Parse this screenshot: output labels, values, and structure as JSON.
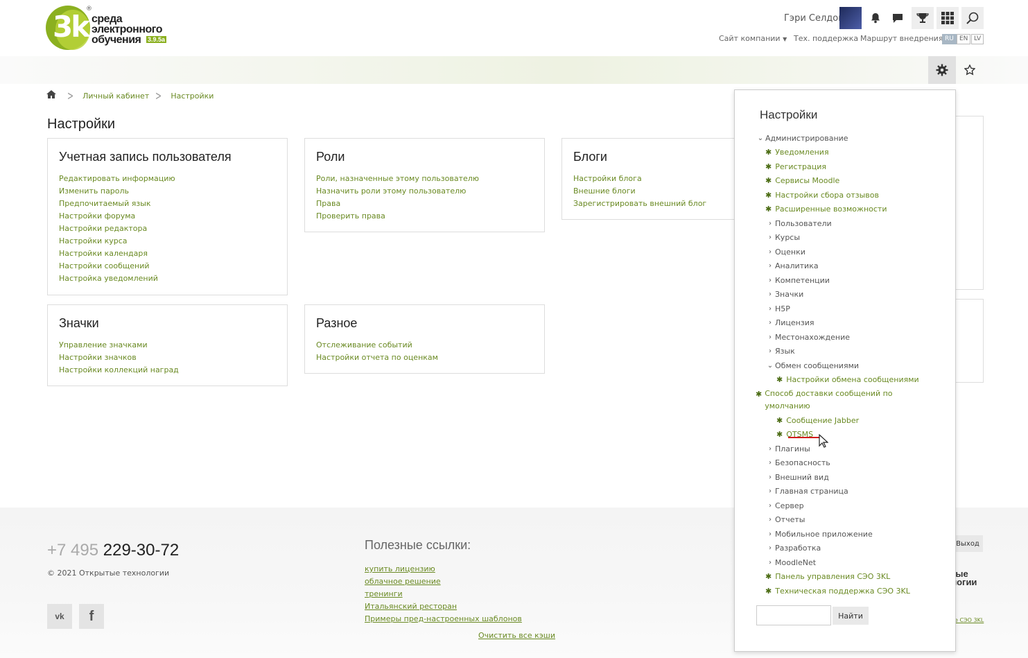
{
  "logo": {
    "mark": "3k",
    "reg": "®",
    "line1": "среда",
    "line2": "электронного",
    "line3": "обучения",
    "version": "3.9.5a"
  },
  "header": {
    "user_name": "Гэри Селдон",
    "top_links": {
      "company": "Сайт компании",
      "support": "Тех. поддержка",
      "route": "Маршрут внедрения"
    },
    "languages": [
      "RU",
      "EN",
      "LV"
    ],
    "active_language": "RU"
  },
  "breadcrumb": {
    "items": [
      "Личный кабинет",
      "Настройки"
    ]
  },
  "page": {
    "title": "Настройки"
  },
  "cards": {
    "account": {
      "title": "Учетная запись пользователя",
      "links": [
        "Редактировать информацию",
        "Изменить пароль",
        "Предпочитаемый язык",
        "Настройки форума",
        "Настройки редактора",
        "Настройки курса",
        "Настройки календаря",
        "Настройки сообщений",
        "Настройка уведомлений"
      ]
    },
    "roles": {
      "title": "Роли",
      "links": [
        "Роли, назначенные этому пользователю",
        "Назначить роли этому пользователю",
        "Права",
        "Проверить права"
      ]
    },
    "blogs": {
      "title": "Блоги",
      "links": [
        "Настройки блога",
        "Внешние блоги",
        "Зарегистрировать внешний блог"
      ]
    },
    "badges": {
      "title": "Значки",
      "links": [
        "Управление значками",
        "Настройки значков",
        "Настройки коллекций наград"
      ]
    },
    "misc": {
      "title": "Разное",
      "links": [
        "Отслеживание событий",
        "Настройки отчета по оценкам"
      ]
    }
  },
  "settings_menu": {
    "title": "Настройки",
    "root": "Администрирование",
    "items": [
      "Уведомления",
      "Регистрация",
      "Сервисы Moodle",
      "Настройки сбора отзывов",
      "Расширенные возможности",
      "Пользователи",
      "Курсы",
      "Оценки",
      "Аналитика",
      "Компетенции",
      "Значки",
      "H5P",
      "Лицензия",
      "Местонахождение",
      "Язык",
      "Обмен сообщениями",
      "Плагины",
      "Безопасность",
      "Внешний вид",
      "Главная страница",
      "Сервер",
      "Отчеты",
      "Мобильное приложение",
      "Разработка",
      "MoodleNet",
      "Панель управления СЭО 3KL",
      "Техническая поддержка СЭО 3KL"
    ],
    "messaging_children": [
      "Настройки обмена сообщениями",
      "Способ доставки сообщений по умолчанию",
      "Сообщение Jabber",
      "OTSMS"
    ],
    "search_button": "Найти",
    "search_value": ""
  },
  "footer": {
    "phone_prefix": "+7 495",
    "phone_number": "229-30-72",
    "copyright": "© 2021  Открытые технологии",
    "useful_title": "Полезные ссылки:",
    "useful_links": [
      "купить лицензию",
      "облачное решение",
      "тренинги",
      "Итальянский ресторан",
      "Примеры пред-настроенных шаблонов"
    ],
    "clear_cache": "Очистить все кэши",
    "logout": "Выход",
    "company_logo_line1": "тые",
    "company_logo_line2": "логии",
    "small_link": "е СЭО 3KL",
    "social": [
      "vk",
      "f"
    ]
  },
  "colors": {
    "accent": "#6a8a23",
    "brand_green": "#8bb020",
    "annotation_red": "#d21b1b"
  }
}
